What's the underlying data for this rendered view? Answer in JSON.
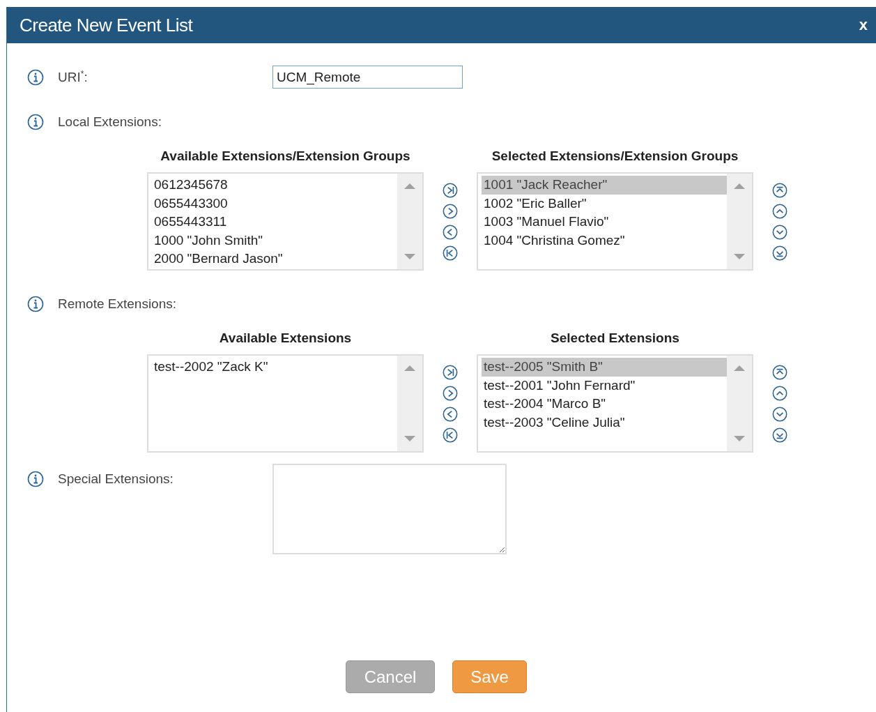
{
  "dialog": {
    "title": "Create New Event List",
    "close": "x"
  },
  "uri": {
    "label": "URI$^{*}$:",
    "value": "UCM_Remote"
  },
  "local_extensions": {
    "label": "Local Extensions:",
    "available": {
      "title": "Available Extensions/Extension Groups",
      "items": [
        {
          "text": "0612345678",
          "selected": false
        },
        {
          "text": "0655443300",
          "selected": false
        },
        {
          "text": "0655443311",
          "selected": false
        },
        {
          "text": "1000 \"John Smith\"",
          "selected": false
        },
        {
          "text": "2000 \"Bernard Jason\"",
          "selected": false
        }
      ]
    },
    "chosen": {
      "title": "Selected Extensions/Extension Groups",
      "items": [
        {
          "text": "1001 \"Jack Reacher\"",
          "selected": true
        },
        {
          "text": "1002 \"Eric Baller\"",
          "selected": false
        },
        {
          "text": "1003 \"Manuel Flavio\"",
          "selected": false
        },
        {
          "text": "1004 \"Christina Gomez\"",
          "selected": false
        }
      ]
    }
  },
  "remote_extensions": {
    "label": "Remote Extensions:",
    "available": {
      "title": "Available Extensions",
      "items": [
        {
          "text": "test--2002 \"Zack K\"",
          "selected": false
        }
      ]
    },
    "chosen": {
      "title": "Selected Extensions",
      "items": [
        {
          "text": "test--2005 \"Smith B\"",
          "selected": true
        },
        {
          "text": "test--2001 \"John Fernard\"",
          "selected": false
        },
        {
          "text": "test--2004 \"Marco B\"",
          "selected": false
        },
        {
          "text": "test--2003 \"Celine Julia\"",
          "selected": false
        }
      ]
    }
  },
  "special_extensions": {
    "label": "Special Extensions:"
  },
  "buttons": [
    {
      "label": "Cancel",
      "kind": "secondary"
    },
    {
      "label": "Save",
      "kind": "primary"
    }
  ]
}
